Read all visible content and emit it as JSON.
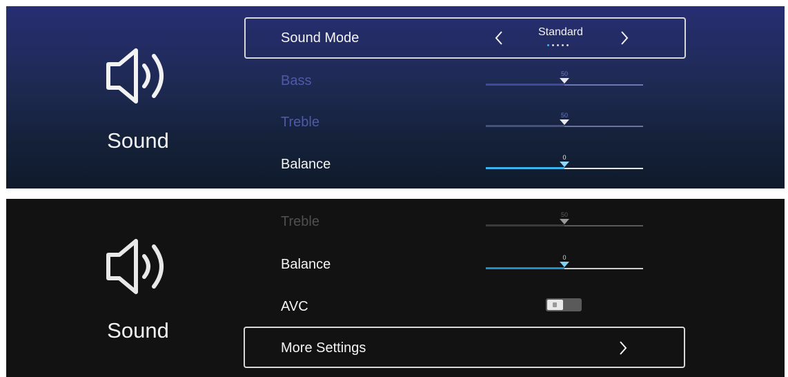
{
  "colors": {
    "accent": "#3fb3ee",
    "top_background": "#1f2a55",
    "bottom_background": "#121212",
    "selection_border": "#d8d8d8"
  },
  "screen_top": {
    "sidebar": {
      "icon": "speaker-volume-icon",
      "label": "Sound"
    },
    "rows": [
      {
        "label": "Sound Mode",
        "value": "Standard",
        "option_count": 5,
        "selected_option_index": 0,
        "selected": true
      },
      {
        "label": "Bass",
        "value": "50"
      },
      {
        "label": "Treble",
        "value": "50"
      },
      {
        "label": "Balance",
        "value": "0"
      }
    ]
  },
  "screen_bottom": {
    "sidebar": {
      "icon": "speaker-volume-icon",
      "label": "Sound"
    },
    "rows": [
      {
        "label": "Treble",
        "value": "50"
      },
      {
        "label": "Balance",
        "value": "0"
      },
      {
        "label": "AVC",
        "toggle_on": false
      },
      {
        "label": "More Settings",
        "selected": true
      }
    ]
  }
}
